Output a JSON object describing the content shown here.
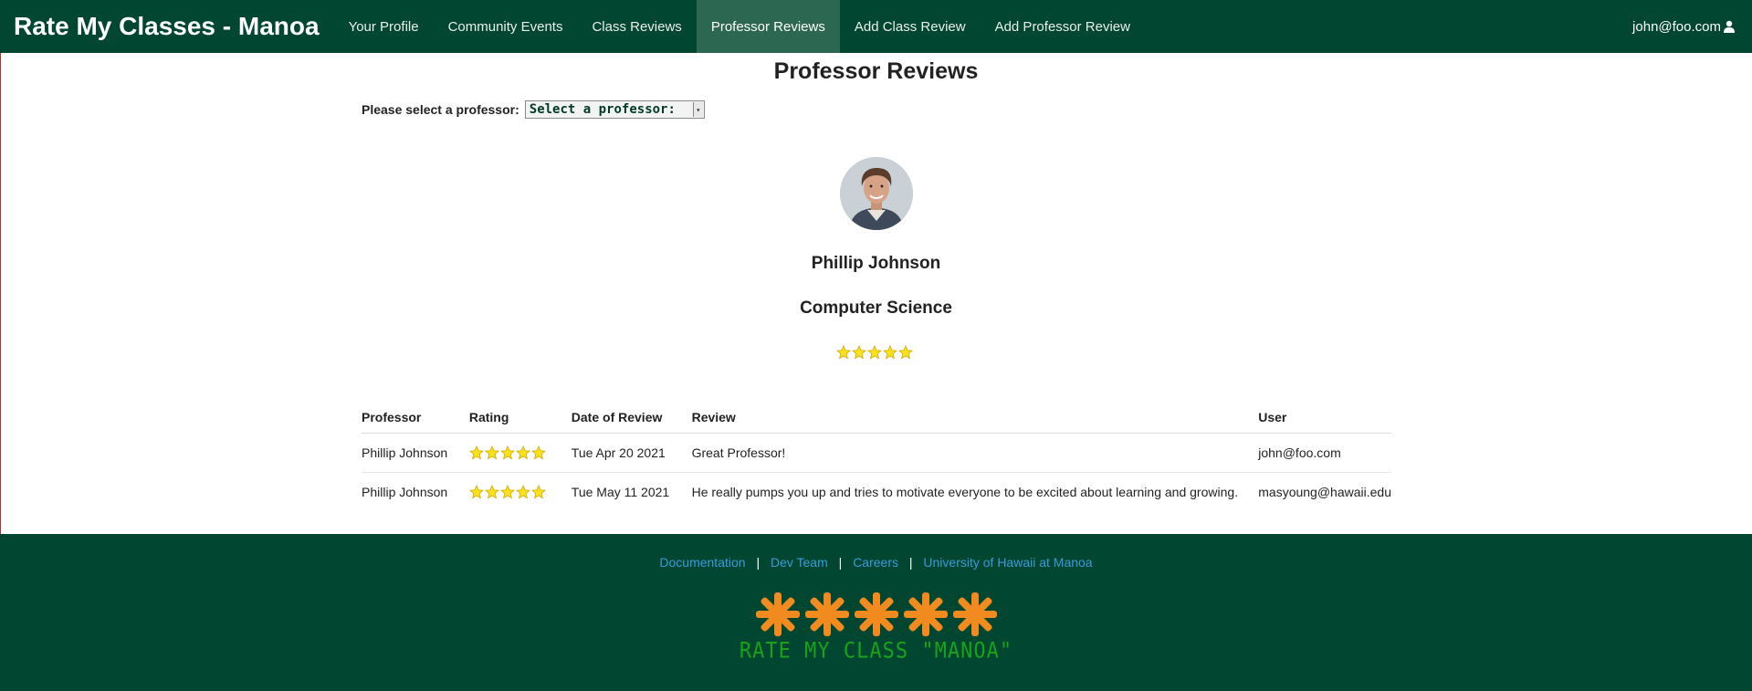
{
  "nav": {
    "brand": "Rate My Classes - Manoa",
    "items": [
      {
        "label": "Your Profile"
      },
      {
        "label": "Community Events"
      },
      {
        "label": "Class Reviews"
      },
      {
        "label": "Professor Reviews",
        "active": true
      },
      {
        "label": "Add Class Review"
      },
      {
        "label": "Add Professor Review"
      }
    ],
    "user": "john@foo.com",
    "colors": {
      "background": "#004631",
      "active": "#2b6751"
    }
  },
  "page": {
    "title": "Professor Reviews",
    "select_label": "Please select a professor:",
    "select_value": "Select a professor:"
  },
  "professor": {
    "name": "Phillip Johnson",
    "department": "Computer Science",
    "rating": 5,
    "rating_max": 5
  },
  "table": {
    "headers": {
      "professor": "Professor",
      "rating": "Rating",
      "date": "Date of Review",
      "review": "Review",
      "user": "User"
    },
    "rows": [
      {
        "professor": "Phillip Johnson",
        "rating": 5,
        "date": "Tue Apr 20 2021",
        "review": "Great Professor!",
        "user": "john@foo.com"
      },
      {
        "professor": "Phillip Johnson",
        "rating": 5,
        "date": "Tue May 11 2021",
        "review": "He really pumps you up and tries to motivate everyone to be excited about learning and growing.",
        "user": "masyoung@hawaii.edu"
      }
    ]
  },
  "footer": {
    "links": [
      "Documentation",
      "Dev Team",
      "Careers",
      "University of Hawaii at Manoa"
    ],
    "separator": "|",
    "logo_text": "RATE MY CLASS \"MANOA\"",
    "colors": {
      "background": "#004631",
      "link": "#3a9ad9",
      "logo_star": "#f18a1f",
      "logo_text": "#18a318"
    }
  },
  "icons": {
    "user": "user-icon",
    "star": "star-icon",
    "dropdown": "chevron-down-icon"
  }
}
